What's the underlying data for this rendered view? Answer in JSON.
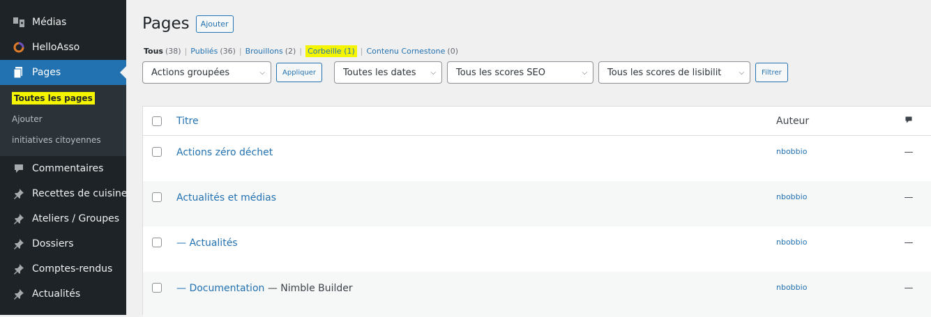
{
  "sidebar": {
    "top_items": [
      {
        "label": "Médias",
        "icon": "media-icon"
      },
      {
        "label": "HelloAsso",
        "icon": "helloasso-icon"
      },
      {
        "label": "Pages",
        "icon": "page-icon"
      }
    ],
    "submenu": [
      "Toutes les pages",
      "Ajouter",
      "initiatives citoyennes"
    ],
    "bottom_items": [
      {
        "label": "Commentaires",
        "icon": "comment-icon"
      },
      {
        "label": "Recettes de cuisine",
        "icon": "pin-icon"
      },
      {
        "label": "Ateliers / Groupes",
        "icon": "pin-icon"
      },
      {
        "label": "Dossiers",
        "icon": "pin-icon"
      },
      {
        "label": "Comptes-rendus",
        "icon": "pin-icon"
      },
      {
        "label": "Actualités",
        "icon": "pin-icon"
      }
    ]
  },
  "header": {
    "title": "Pages",
    "add_label": "Ajouter"
  },
  "views": [
    {
      "label": "Tous",
      "count": "(38)"
    },
    {
      "label": "Publiés",
      "count": "(36)"
    },
    {
      "label": "Brouillons",
      "count": "(2)"
    },
    {
      "label": "Corbeille (1)",
      "count": ""
    },
    {
      "label": "Contenu Cornestone",
      "count": "(0)"
    }
  ],
  "filters": {
    "bulk_actions": "Actions groupées",
    "apply": "Appliquer",
    "dates": "Toutes les dates",
    "seo": "Tous les scores SEO",
    "readability": "Tous les scores de lisibilit",
    "filter": "Filtrer"
  },
  "table": {
    "headers": {
      "title": "Titre",
      "author": "Auteur"
    },
    "rows": [
      {
        "title": "Actions zéro déchet",
        "suffix": "",
        "author": "nbobbio",
        "comments": "—"
      },
      {
        "title": "Actualités et médias",
        "suffix": "",
        "author": "nbobbio",
        "comments": "—"
      },
      {
        "title": "— Actualités",
        "suffix": "",
        "author": "nbobbio",
        "comments": "—"
      },
      {
        "title": "— Documentation",
        "suffix": "— Nimble Builder",
        "author": "nbobbio",
        "comments": "—"
      }
    ]
  },
  "colors": {
    "sidebar_bg": "#1d2327",
    "accent": "#2271b1",
    "highlight": "#f5f500"
  }
}
